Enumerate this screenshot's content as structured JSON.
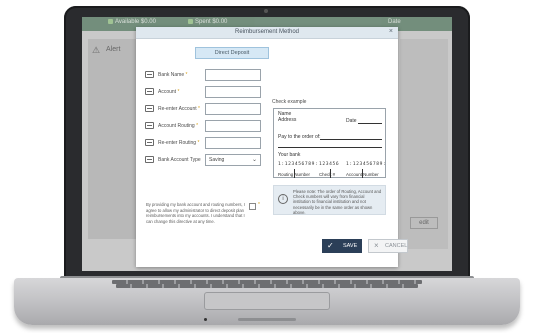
{
  "background_app": {
    "tabs": [
      {
        "label": "Available $0.00"
      },
      {
        "label": "Spent $0.00"
      },
      {
        "label": "Date"
      }
    ],
    "alert_label": "Alert",
    "right_label": "",
    "right_button_label": "edit"
  },
  "modal": {
    "title": "Reimbursement Method",
    "close_glyph": "×",
    "method_button": "Direct Deposit",
    "fields": [
      {
        "label": "Bank Name",
        "required": "*"
      },
      {
        "label": "Account",
        "required": "*"
      },
      {
        "label": "Re-enter Account",
        "required": "*"
      },
      {
        "label": "Account Routing",
        "required": "*"
      },
      {
        "label": "Re-enter Routing",
        "required": "*"
      },
      {
        "label": "Bank Account Type",
        "required": ""
      }
    ],
    "account_type_value": "Saving",
    "consent_text": "By providing my bank account and routing numbers, I agree to allow my administrator to direct deposit plan reimbursements into my accounts. I understand that I can change this directive at any time.",
    "consent_required": "*",
    "check_example": {
      "caption": "Check example",
      "name": "Name",
      "address": "Address",
      "date": "Date",
      "pay_to": "Pay to the order of:",
      "your_bank": "Your bank",
      "routing_digits": "1:123456789:",
      "check_digits": "123456",
      "account_digits": "1:123456789:",
      "routing_label": "Routing Number",
      "check_label": "Check #",
      "account_label": "Account Number"
    },
    "note": {
      "icon_glyph": "i",
      "text": "Please note: The order of Routing, Account and Check numbers will vary from financial institution to financial institution and not necessarily be in the same order as shown above."
    },
    "save_label": "SAVE",
    "save_icon": "✓",
    "cancel_label": "CANCEL",
    "cancel_icon": "×"
  },
  "colors": {
    "save_bg": "#2b3f58",
    "header_bg": "#dfe8ef",
    "method_bg": "#d6e8f5",
    "required": "#d9a21b"
  }
}
